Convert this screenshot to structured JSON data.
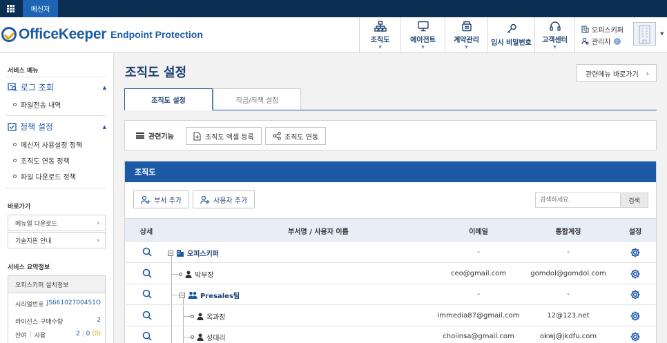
{
  "topbar": {
    "messenger_tab": "메신저"
  },
  "brand": {
    "name": "OfficeKeeper",
    "sub": "Endpoint Protection"
  },
  "nav": [
    {
      "label": "조직도",
      "icon": "org-chart-icon",
      "caret": true
    },
    {
      "label": "에이전트",
      "icon": "monitor-icon",
      "caret": true
    },
    {
      "label": "계약관리",
      "icon": "contract-icon",
      "caret": true
    },
    {
      "label": "임시 비밀번호",
      "icon": "key-icon",
      "caret": false
    },
    {
      "label": "고객센터",
      "icon": "headset-icon",
      "caret": true
    }
  ],
  "user": {
    "company": "오피스키퍼",
    "role": "관리자"
  },
  "sidebar": {
    "service_menu_title": "서비스 메뉴",
    "groups": [
      {
        "label": "로그 조회",
        "items": [
          "파일전송 내역"
        ]
      },
      {
        "label": "정책 설정",
        "items": [
          "메신저 사용설정 정책",
          "조직도 연동 정책",
          "파일 다운로드 정책"
        ]
      }
    ],
    "shortcut_title": "바로가기",
    "shortcuts": [
      "메뉴얼 다운로드",
      "기술지원 안내"
    ],
    "summary_title": "서비스 요약정보",
    "summary": {
      "box_title": "오피스키퍼 설치정보",
      "serial_label": "시리얼번호",
      "serial_value": "JS66102700451O",
      "license_label": "라이선스 구매수량",
      "license_value": "2",
      "remain_label": "잔여",
      "use_label": "사용",
      "remain_value": "2",
      "use_value": "0",
      "extra_value": "(0)"
    }
  },
  "main": {
    "title": "조직도 설정",
    "related_button": "관련메뉴 바로가기",
    "tabs": [
      "조직도 설정",
      "직급/직책 설정"
    ],
    "func_label": "관련기능",
    "func_buttons": [
      "조직도 엑셀 등록",
      "조직도 연동"
    ],
    "panel_title": "조직도",
    "add_dept": "부서 추가",
    "add_user": "사용자 추가",
    "search_placeholder": "검색하세요.",
    "search_button": "검색",
    "columns": [
      "상세",
      "부서명 / 사용자 이름",
      "이메일",
      "통합계정",
      "설정"
    ],
    "rows": [
      {
        "type": "dept",
        "name": "오피스키퍼",
        "email": "-",
        "account": "-",
        "level": 0
      },
      {
        "type": "user",
        "name": "박부장",
        "email": "ceo@gmail.com",
        "account": "gomdol@gomdol.com",
        "level": 1
      },
      {
        "type": "dept",
        "name": "Presales팀",
        "email": "-",
        "account": "-",
        "level": 1
      },
      {
        "type": "user",
        "name": "옥과장",
        "email": "immedia87@gmail.com",
        "account": "12@123.net",
        "level": 2
      },
      {
        "type": "user",
        "name": "성대리",
        "email": "choiinsa@gmail.com",
        "account": "okwj@jkdfu.com",
        "level": 2
      }
    ]
  },
  "colors": {
    "brand_blue": "#1d5aa6",
    "topbar_navy": "#0a2f52",
    "accent_orange": "#e8a10c"
  }
}
